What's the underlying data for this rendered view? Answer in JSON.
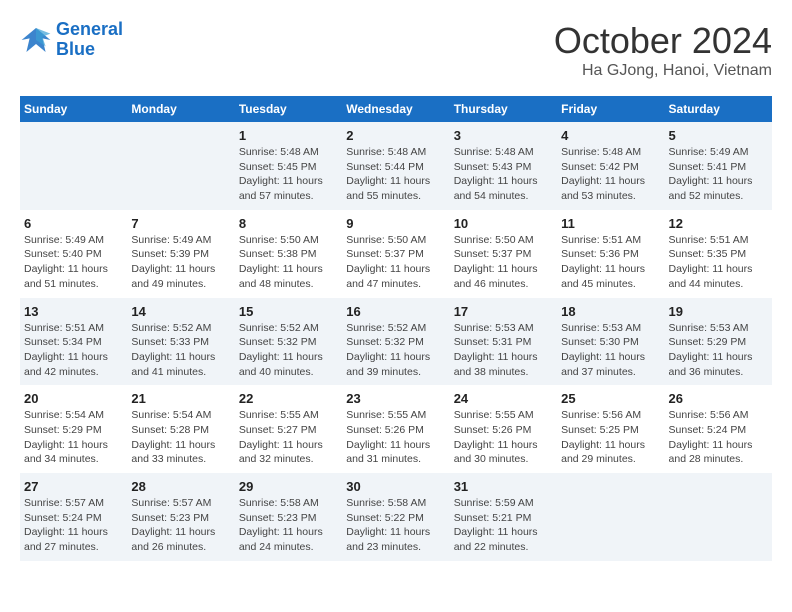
{
  "header": {
    "logo_line1": "General",
    "logo_line2": "Blue",
    "month": "October 2024",
    "location": "Ha GJong, Hanoi, Vietnam"
  },
  "days_of_week": [
    "Sunday",
    "Monday",
    "Tuesday",
    "Wednesday",
    "Thursday",
    "Friday",
    "Saturday"
  ],
  "weeks": [
    [
      {
        "day": "",
        "info": ""
      },
      {
        "day": "",
        "info": ""
      },
      {
        "day": "1",
        "info": "Sunrise: 5:48 AM\nSunset: 5:45 PM\nDaylight: 11 hours\nand 57 minutes."
      },
      {
        "day": "2",
        "info": "Sunrise: 5:48 AM\nSunset: 5:44 PM\nDaylight: 11 hours\nand 55 minutes."
      },
      {
        "day": "3",
        "info": "Sunrise: 5:48 AM\nSunset: 5:43 PM\nDaylight: 11 hours\nand 54 minutes."
      },
      {
        "day": "4",
        "info": "Sunrise: 5:48 AM\nSunset: 5:42 PM\nDaylight: 11 hours\nand 53 minutes."
      },
      {
        "day": "5",
        "info": "Sunrise: 5:49 AM\nSunset: 5:41 PM\nDaylight: 11 hours\nand 52 minutes."
      }
    ],
    [
      {
        "day": "6",
        "info": "Sunrise: 5:49 AM\nSunset: 5:40 PM\nDaylight: 11 hours\nand 51 minutes."
      },
      {
        "day": "7",
        "info": "Sunrise: 5:49 AM\nSunset: 5:39 PM\nDaylight: 11 hours\nand 49 minutes."
      },
      {
        "day": "8",
        "info": "Sunrise: 5:50 AM\nSunset: 5:38 PM\nDaylight: 11 hours\nand 48 minutes."
      },
      {
        "day": "9",
        "info": "Sunrise: 5:50 AM\nSunset: 5:37 PM\nDaylight: 11 hours\nand 47 minutes."
      },
      {
        "day": "10",
        "info": "Sunrise: 5:50 AM\nSunset: 5:37 PM\nDaylight: 11 hours\nand 46 minutes."
      },
      {
        "day": "11",
        "info": "Sunrise: 5:51 AM\nSunset: 5:36 PM\nDaylight: 11 hours\nand 45 minutes."
      },
      {
        "day": "12",
        "info": "Sunrise: 5:51 AM\nSunset: 5:35 PM\nDaylight: 11 hours\nand 44 minutes."
      }
    ],
    [
      {
        "day": "13",
        "info": "Sunrise: 5:51 AM\nSunset: 5:34 PM\nDaylight: 11 hours\nand 42 minutes."
      },
      {
        "day": "14",
        "info": "Sunrise: 5:52 AM\nSunset: 5:33 PM\nDaylight: 11 hours\nand 41 minutes."
      },
      {
        "day": "15",
        "info": "Sunrise: 5:52 AM\nSunset: 5:32 PM\nDaylight: 11 hours\nand 40 minutes."
      },
      {
        "day": "16",
        "info": "Sunrise: 5:52 AM\nSunset: 5:32 PM\nDaylight: 11 hours\nand 39 minutes."
      },
      {
        "day": "17",
        "info": "Sunrise: 5:53 AM\nSunset: 5:31 PM\nDaylight: 11 hours\nand 38 minutes."
      },
      {
        "day": "18",
        "info": "Sunrise: 5:53 AM\nSunset: 5:30 PM\nDaylight: 11 hours\nand 37 minutes."
      },
      {
        "day": "19",
        "info": "Sunrise: 5:53 AM\nSunset: 5:29 PM\nDaylight: 11 hours\nand 36 minutes."
      }
    ],
    [
      {
        "day": "20",
        "info": "Sunrise: 5:54 AM\nSunset: 5:29 PM\nDaylight: 11 hours\nand 34 minutes."
      },
      {
        "day": "21",
        "info": "Sunrise: 5:54 AM\nSunset: 5:28 PM\nDaylight: 11 hours\nand 33 minutes."
      },
      {
        "day": "22",
        "info": "Sunrise: 5:55 AM\nSunset: 5:27 PM\nDaylight: 11 hours\nand 32 minutes."
      },
      {
        "day": "23",
        "info": "Sunrise: 5:55 AM\nSunset: 5:26 PM\nDaylight: 11 hours\nand 31 minutes."
      },
      {
        "day": "24",
        "info": "Sunrise: 5:55 AM\nSunset: 5:26 PM\nDaylight: 11 hours\nand 30 minutes."
      },
      {
        "day": "25",
        "info": "Sunrise: 5:56 AM\nSunset: 5:25 PM\nDaylight: 11 hours\nand 29 minutes."
      },
      {
        "day": "26",
        "info": "Sunrise: 5:56 AM\nSunset: 5:24 PM\nDaylight: 11 hours\nand 28 minutes."
      }
    ],
    [
      {
        "day": "27",
        "info": "Sunrise: 5:57 AM\nSunset: 5:24 PM\nDaylight: 11 hours\nand 27 minutes."
      },
      {
        "day": "28",
        "info": "Sunrise: 5:57 AM\nSunset: 5:23 PM\nDaylight: 11 hours\nand 26 minutes."
      },
      {
        "day": "29",
        "info": "Sunrise: 5:58 AM\nSunset: 5:23 PM\nDaylight: 11 hours\nand 24 minutes."
      },
      {
        "day": "30",
        "info": "Sunrise: 5:58 AM\nSunset: 5:22 PM\nDaylight: 11 hours\nand 23 minutes."
      },
      {
        "day": "31",
        "info": "Sunrise: 5:59 AM\nSunset: 5:21 PM\nDaylight: 11 hours\nand 22 minutes."
      },
      {
        "day": "",
        "info": ""
      },
      {
        "day": "",
        "info": ""
      }
    ]
  ]
}
